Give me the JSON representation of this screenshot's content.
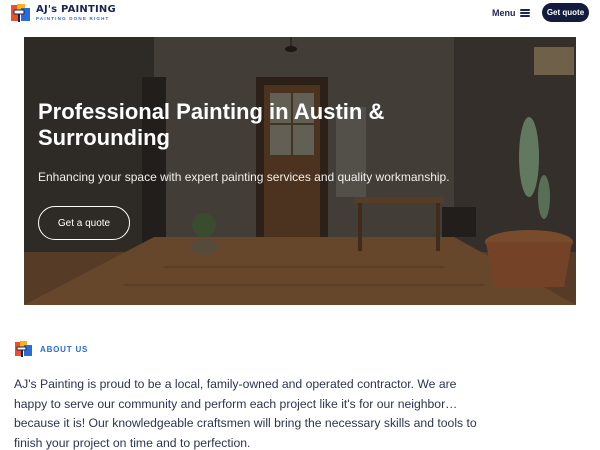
{
  "brand": {
    "name": "AJ's PAINTING",
    "tagline": "PAINTING DONE RIGHT"
  },
  "nav": {
    "menu_label": "Menu",
    "cta_label": "Get quote"
  },
  "hero": {
    "title_bold": "Professional Painting",
    "title_rest": " in Austin & Surrounding",
    "subtitle": "Enhancing your space with expert painting services and quality workmanship.",
    "cta_label": "Get a quote"
  },
  "about": {
    "label": "ABOUT US",
    "text": "AJ's Painting is proud to be a local, family-owned and operated contractor. We are happy to serve our community and perform each project like it's for our neighbor… because it is! Our knowledgeable craftsmen will bring the necessary skills and tools to finish your project on time and to perfection."
  },
  "colors": {
    "brand_navy": "#141c3d",
    "accent_blue": "#2a6bd6",
    "body_text": "#2c3550"
  },
  "icons": {
    "logo": "paint-roller-logo-icon",
    "menu": "hamburger-icon",
    "about": "paint-roller-logo-icon"
  }
}
